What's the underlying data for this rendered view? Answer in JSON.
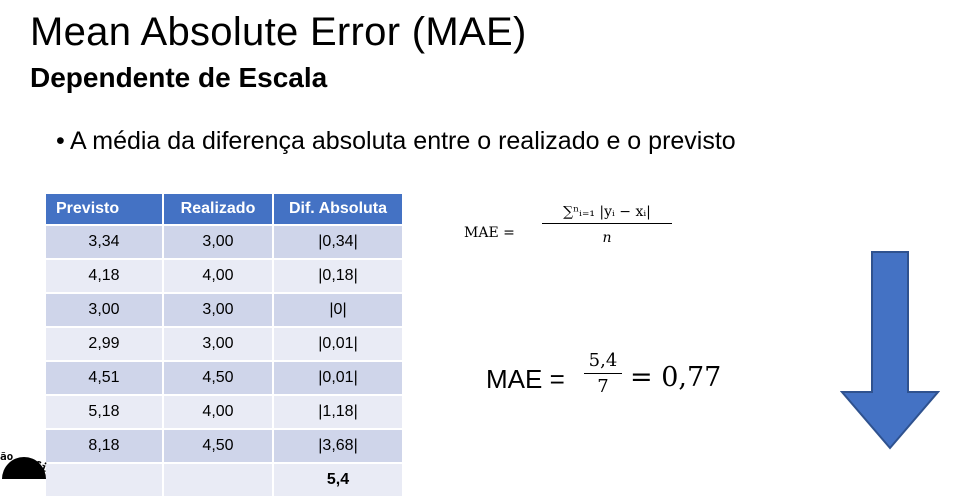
{
  "slide": {
    "title": "Mean Absolute Error (MAE)",
    "subtitle": "Dependente de Escala",
    "bullet": "A média da diferença absoluta entre o realizado e o previsto"
  },
  "table": {
    "headers": [
      "Previsto",
      "Realizado",
      "Dif. Absoluta"
    ],
    "rows": [
      [
        "3,34",
        "3,00",
        "|0,34|"
      ],
      [
        "4,18",
        "4,00",
        "|0,18|"
      ],
      [
        "3,00",
        "3,00",
        "|0|"
      ],
      [
        "2,99",
        "3,00",
        "|0,01|"
      ],
      [
        "4,51",
        "4,50",
        "|0,01|"
      ],
      [
        "5,18",
        "4,00",
        "|1,18|"
      ],
      [
        "8,18",
        "4,50",
        "|3,68|"
      ]
    ],
    "total": [
      "",
      "",
      "5,4"
    ]
  },
  "formula_general": {
    "lhs": "MAE =",
    "numerator": "∑ⁿᵢ₌₁ |yᵢ − xᵢ|",
    "denominator": "n"
  },
  "formula_result": {
    "lhs": "MAE =",
    "numerator": "5,4",
    "denominator": "7",
    "rhs": "= 0,77"
  },
  "logo": {
    "text_left": "ão",
    "text_right": "Ci"
  },
  "colors": {
    "header": "#4472c4",
    "row_dark": "#cfd5ea",
    "row_light": "#e9ebf5",
    "arrow": "#4472c4",
    "arrow_border": "#2f528f"
  }
}
